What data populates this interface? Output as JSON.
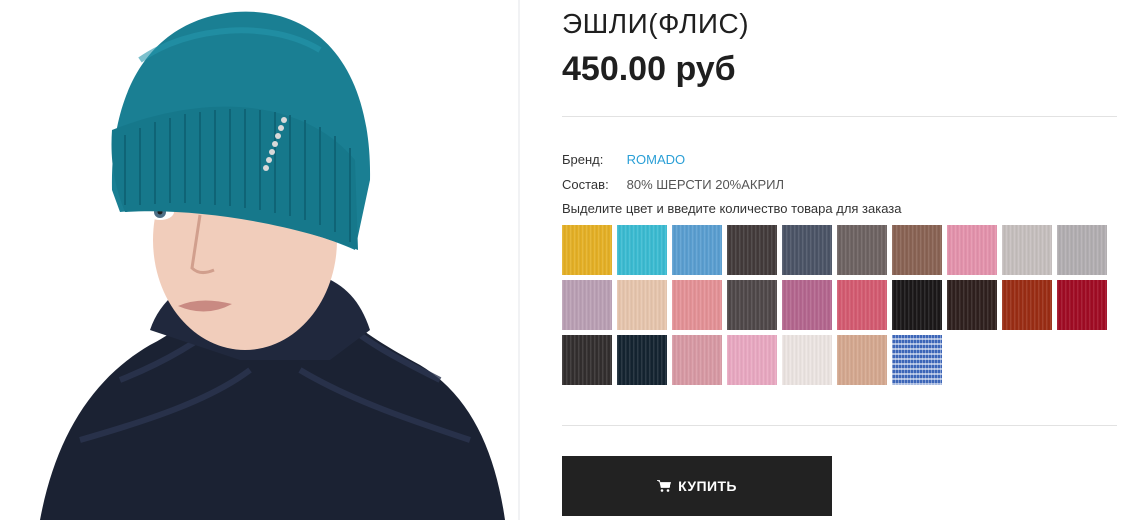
{
  "product": {
    "title": "ЭШЛИ(ФЛИС)",
    "price": "450.00 руб",
    "image_alt": "Woman wearing a teal knitted beanie hat and a dark navy puffer jacket"
  },
  "attributes": {
    "brand_label": "Бренд:",
    "brand_value": "ROMADO",
    "composition_label": "Состав:",
    "composition_value": "80% ШЕРСТИ 20%АКРИЛ"
  },
  "hint": "Выделите цвет и введите количество товара для заказа",
  "swatches": [
    {
      "color": "#e6b125"
    },
    {
      "color": "#3bbcd3"
    },
    {
      "color": "#5a9fd2"
    },
    {
      "color": "#423b3b"
    },
    {
      "color": "#4b5466"
    },
    {
      "color": "#6e6362"
    },
    {
      "color": "#8a6354"
    },
    {
      "color": "#e593ad"
    },
    {
      "color": "#c7c0bf"
    },
    {
      "color": "#b3afb2"
    },
    {
      "color": "#bba0b5"
    },
    {
      "color": "#e8c6ae"
    },
    {
      "color": "#e59297"
    },
    {
      "color": "#4f4849"
    },
    {
      "color": "#b5668f"
    },
    {
      "color": "#d55b71"
    },
    {
      "color": "#1a1718"
    },
    {
      "color": "#2f201e"
    },
    {
      "color": "#9b2d14"
    },
    {
      "color": "#a10b24"
    },
    {
      "color": "#322e2e"
    },
    {
      "color": "#142431"
    },
    {
      "color": "#d99aa5"
    },
    {
      "color": "#eaa9c2"
    },
    {
      "color": "#ede6e3"
    },
    {
      "color": "#d6a990"
    },
    {
      "color": "#3d66b8",
      "speckle": true
    }
  ],
  "buy_button": {
    "label": "КУПИТЬ",
    "icon": "cart-icon"
  },
  "colors": {
    "accent_link": "#2a9fd6",
    "button_bg": "#222222",
    "button_text": "#ffffff"
  }
}
